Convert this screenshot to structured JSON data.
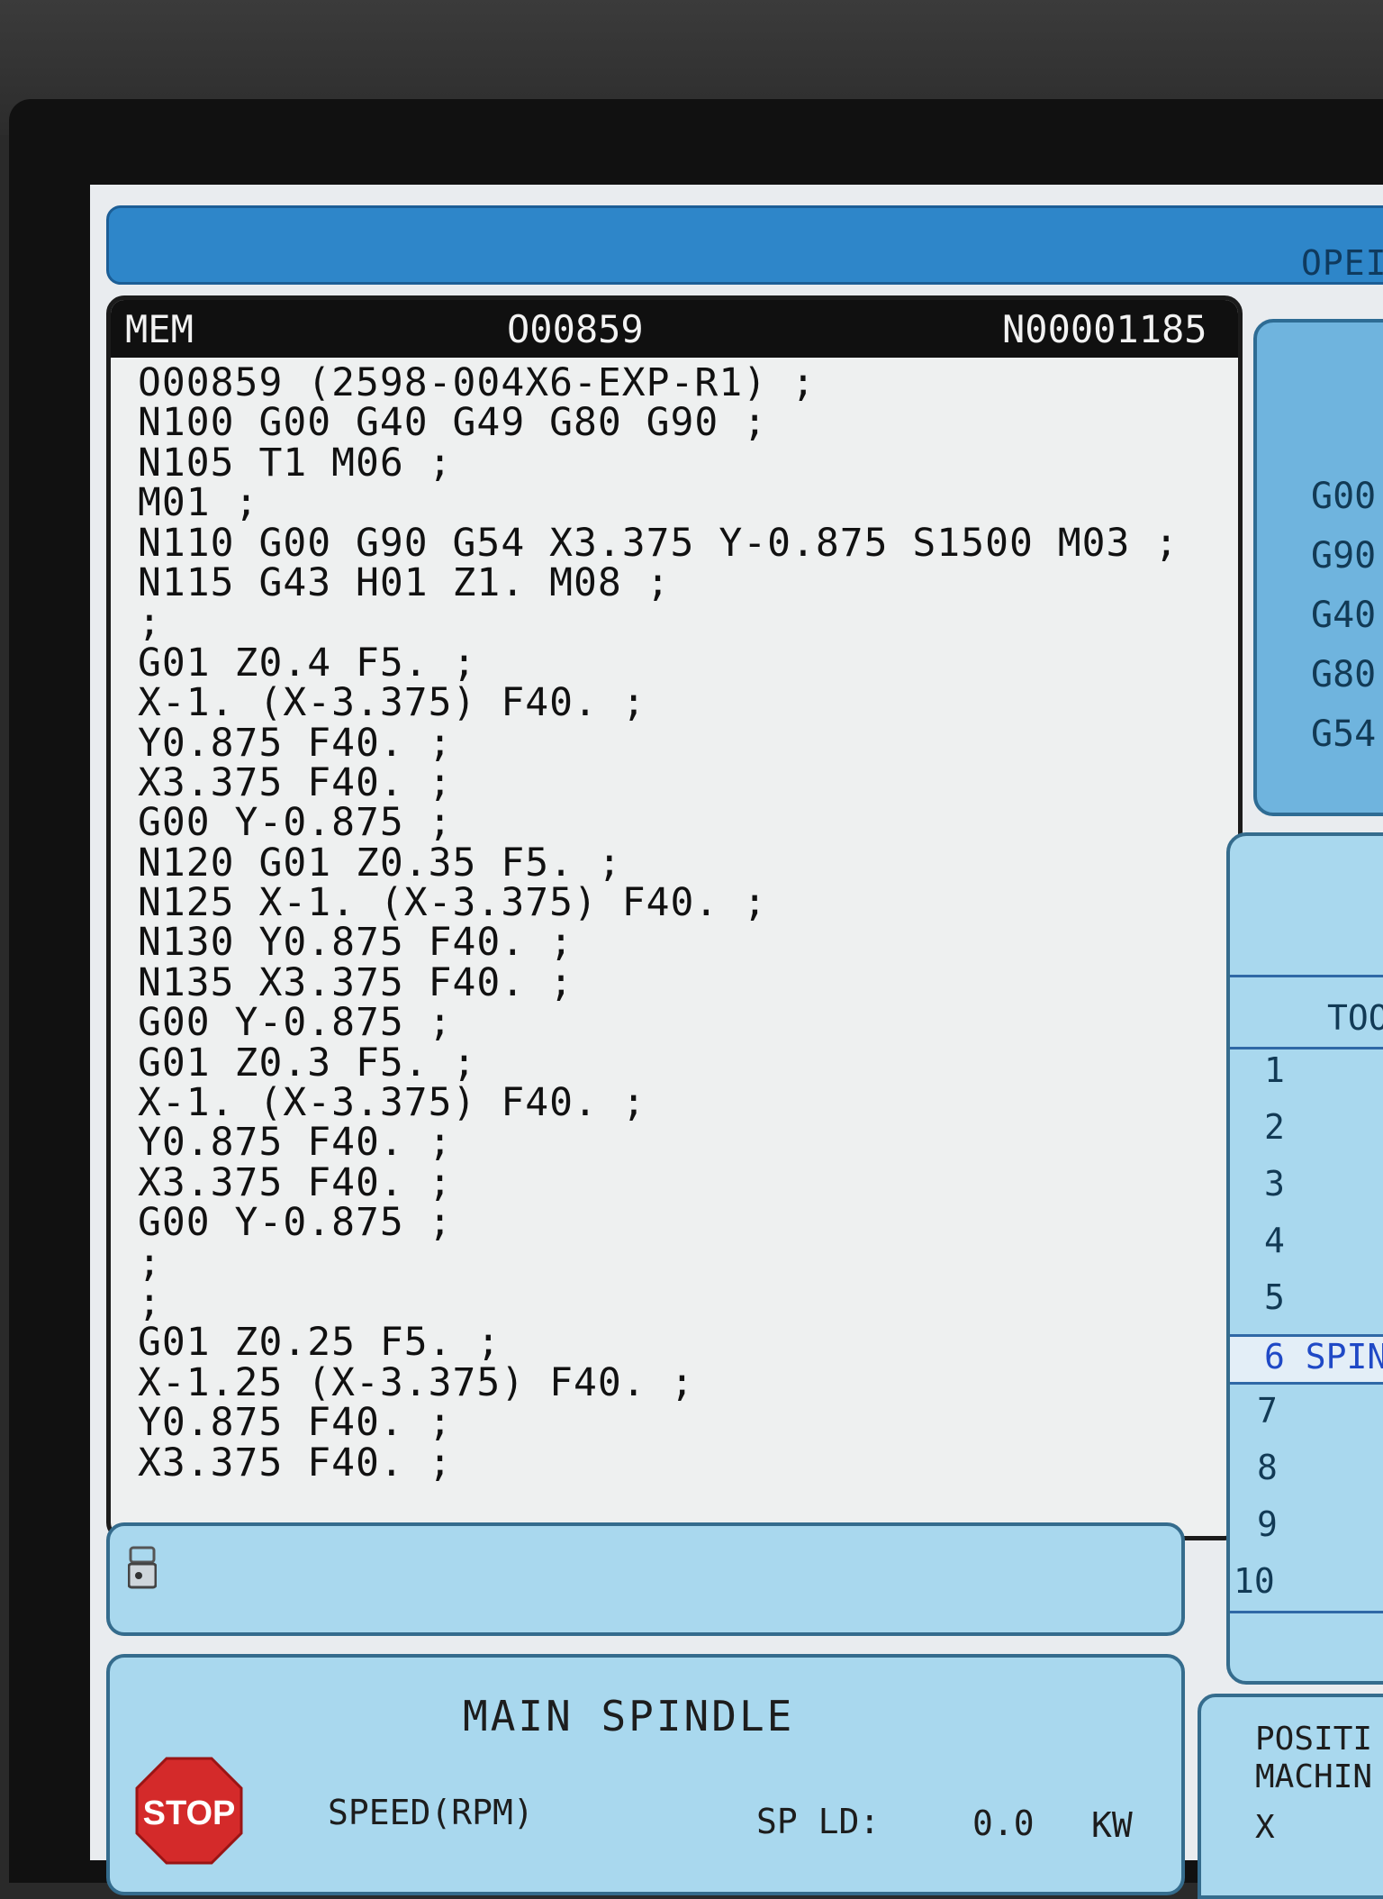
{
  "header": {
    "operation_label": "OPEI"
  },
  "program": {
    "mode": "MEM",
    "program_number": "O00859",
    "sequence_number": "N00001185",
    "lines": [
      "O00859 (2598-004X6-EXP-R1) ;",
      "N100 G00 G40 G49 G80 G90 ;",
      "N105 T1 M06 ;",
      "M01 ;",
      "N110 G00 G90 G54 X3.375 Y-0.875 S1500 M03 ;",
      "N115 G43 H01 Z1. M08 ;",
      ";",
      "G01 Z0.4 F5. ;",
      "X-1. (X-3.375) F40. ;",
      "Y0.875 F40. ;",
      "X3.375 F40. ;",
      "G00 Y-0.875 ;",
      "N120 G01 Z0.35 F5. ;",
      "N125 X-1. (X-3.375) F40. ;",
      "N130 Y0.875 F40. ;",
      "N135 X3.375 F40. ;",
      "G00 Y-0.875 ;",
      "G01 Z0.3 F5. ;",
      "X-1. (X-3.375) F40. ;",
      "Y0.875 F40. ;",
      "X3.375 F40. ;",
      "G00 Y-0.875 ;",
      ";",
      ";",
      "G01 Z0.25 F5. ;",
      "X-1.25 (X-3.375) F40. ;",
      "Y0.875 F40. ;",
      "X3.375 F40. ;"
    ]
  },
  "modal_codes": [
    "G00",
    "G90",
    "G40",
    "G80",
    "G54"
  ],
  "tools": {
    "header": "TOO",
    "rows": [
      "1",
      "2",
      "3",
      "4",
      "5",
      "6 SPIN",
      "7",
      "8",
      "9",
      "10"
    ],
    "active_row": "6 SPIN"
  },
  "spindle": {
    "title": "MAIN SPINDLE",
    "stop_label": "STOP",
    "speed_label": "SPEED(RPM)",
    "load_label": "SP LD:",
    "load_value": "0.0",
    "load_unit": "KW"
  },
  "position": {
    "line1": "POSITI",
    "line2": "MACHIN",
    "axis": "X"
  },
  "colors": {
    "screen_blue": "#2e86c9",
    "panel_light_blue": "#a9d8ee",
    "stop_red": "#d42a2a",
    "highlight_blue": "#1f49c6"
  }
}
